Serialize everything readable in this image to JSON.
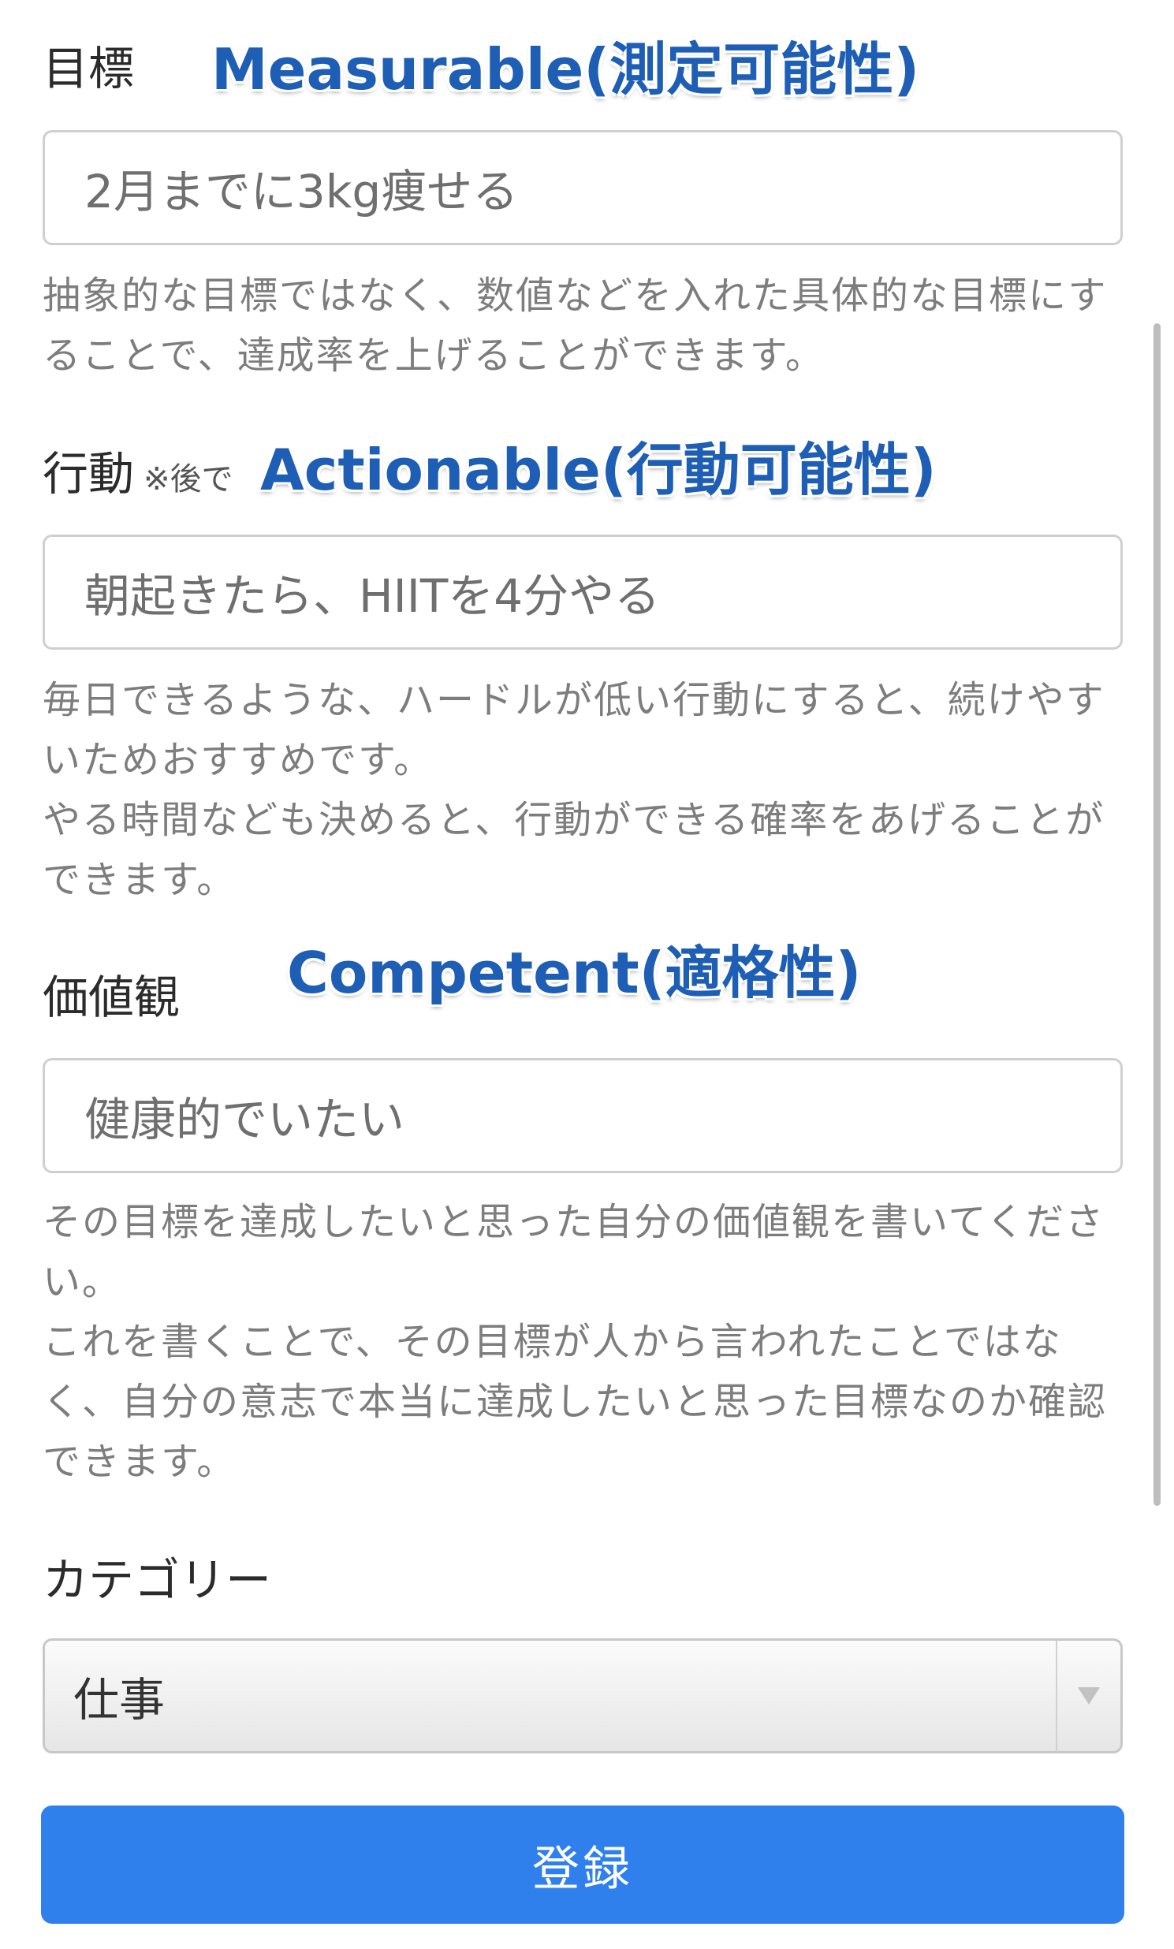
{
  "form": {
    "goal": {
      "label": "目標",
      "value": "2月までに3kg痩せる",
      "help": [
        "抽象的な目標ではなく、数値などを入れた具体的な目標にすることで、達成率を上げることができます。"
      ]
    },
    "action": {
      "label": "行動",
      "note": "※後で",
      "value": "朝起きたら、HIITを4分やる",
      "help": [
        "毎日できるような、ハードルが低い行動にすると、続けやすいためおすすめです。",
        "やる時間なども決めると、行動ができる確率をあげることができます。"
      ]
    },
    "values": {
      "label": "価値観",
      "value": "健康的でいたい",
      "help": [
        "その目標を達成したいと思った自分の価値観を書いてください。",
        "これを書くことで、その目標が人から言われたことではなく、自分の意志で本当に達成したいと思った目標なのか確認できます。"
      ]
    },
    "category": {
      "label": "カテゴリー",
      "selected": "仕事"
    },
    "submit_label": "登録"
  },
  "annotations": {
    "measurable": "Measurable(測定可能性)",
    "actionable": "Actionable(行動可能性)",
    "competent": "Competent(適格性)",
    "color": "#1e5fb5"
  },
  "colors": {
    "button": "#2f80ed",
    "help_text": "#7d7d7d",
    "input_border": "#cfcfcf"
  },
  "icons": {
    "select_arrow": "chevron-down-icon"
  }
}
